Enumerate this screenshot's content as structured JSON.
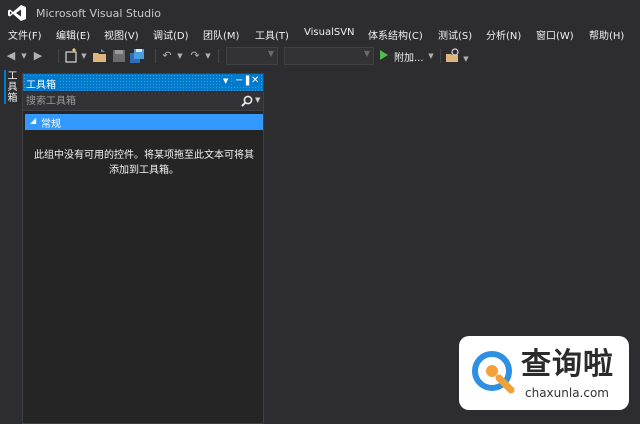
{
  "app": {
    "title": "Microsoft Visual Studio",
    "logo_icon": "visual-studio-logo-icon",
    "accent": "#007acc"
  },
  "menu": {
    "items": [
      {
        "label": "文件(F)"
      },
      {
        "label": "编辑(E)"
      },
      {
        "label": "视图(V)"
      },
      {
        "label": "调试(D)"
      },
      {
        "label": "团队(M)"
      },
      {
        "label": "工具(T)"
      },
      {
        "label": "VisualSVN"
      },
      {
        "label": "体系结构(C)"
      },
      {
        "label": "测试(S)"
      },
      {
        "label": "分析(N)"
      },
      {
        "label": "窗口(W)"
      },
      {
        "label": "帮助(H)"
      }
    ]
  },
  "toolbar": {
    "run_label": "附加...",
    "icons": [
      "back-icon",
      "forward-icon",
      "new-project-icon",
      "open-file-icon",
      "save-icon",
      "save-all-icon",
      "undo-icon",
      "redo-icon",
      "start-icon",
      "find-in-files-icon"
    ]
  },
  "side_tab": {
    "label": "工具箱"
  },
  "toolbox": {
    "title": "工具箱",
    "search_placeholder": "搜索工具箱",
    "group_label": "常规",
    "empty_line1": "此组中没有可用的控件。将某项拖至此文本可将其",
    "empty_line2": "添加到工具箱。",
    "header_color": "#007acc",
    "group_color": "#3399ff"
  },
  "watermark": {
    "brand_cn": "查询啦",
    "url": "chaxunla.com",
    "brand_color": "#2f8fe0"
  }
}
